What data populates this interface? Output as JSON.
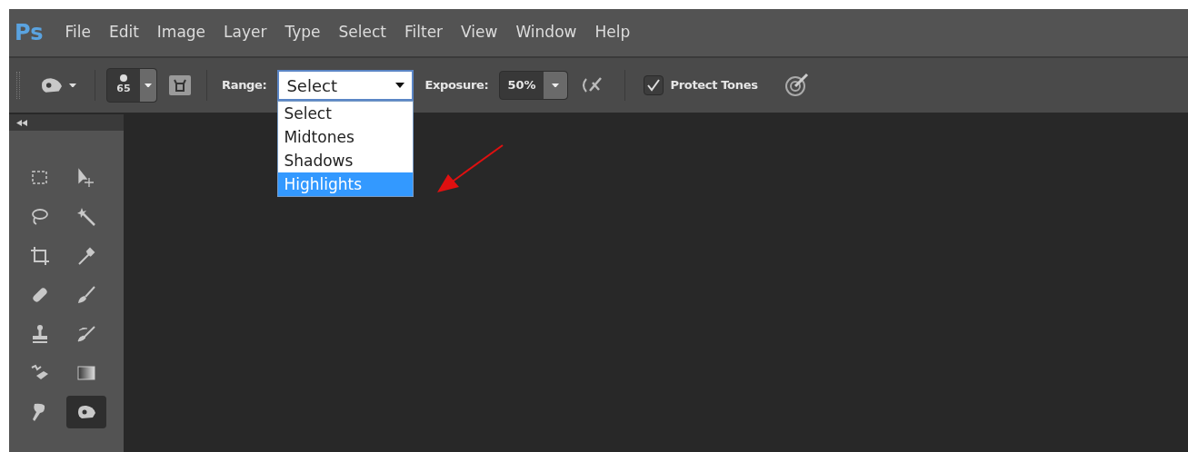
{
  "logo": "Ps",
  "menu": [
    "File",
    "Edit",
    "Image",
    "Layer",
    "Type",
    "Select",
    "Filter",
    "View",
    "Window",
    "Help"
  ],
  "options_bar": {
    "brush_size": "65",
    "range_label": "Range:",
    "range_value": "Select",
    "exposure_label": "Exposure:",
    "exposure_value": "50%",
    "protect_tones": {
      "label": "Protect Tones",
      "checked": true
    }
  },
  "range_dropdown": {
    "options": [
      {
        "label": "Select",
        "selected": false
      },
      {
        "label": "Midtones",
        "selected": false
      },
      {
        "label": "Shadows",
        "selected": false
      },
      {
        "label": "Highlights",
        "selected": true
      }
    ]
  },
  "tools": [
    {
      "kind": "marquee",
      "selected": false
    },
    {
      "kind": "move",
      "selected": false
    },
    {
      "kind": "lasso",
      "selected": false
    },
    {
      "kind": "wand",
      "selected": false
    },
    {
      "kind": "crop",
      "selected": false
    },
    {
      "kind": "eyedropper",
      "selected": false
    },
    {
      "kind": "healing",
      "selected": false
    },
    {
      "kind": "brush",
      "selected": false
    },
    {
      "kind": "stamp",
      "selected": false
    },
    {
      "kind": "history",
      "selected": false
    },
    {
      "kind": "eraser",
      "selected": false
    },
    {
      "kind": "gradient",
      "selected": false
    },
    {
      "kind": "smudge",
      "selected": false
    },
    {
      "kind": "dodge",
      "selected": true
    }
  ]
}
